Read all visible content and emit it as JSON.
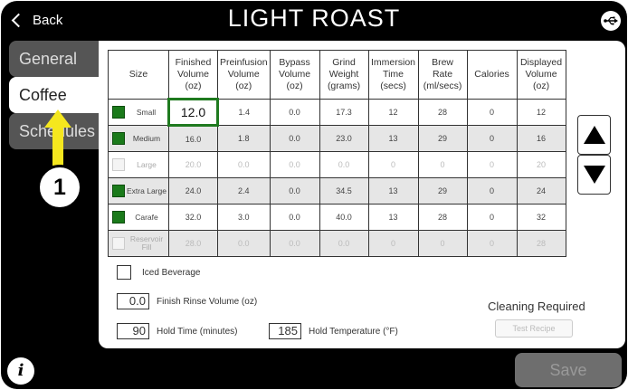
{
  "header": {
    "back_label": "Back",
    "title": "LIGHT ROAST"
  },
  "tabs": [
    {
      "label": "General"
    },
    {
      "label": "Coffee"
    },
    {
      "label": "Schedules"
    }
  ],
  "annotation": {
    "number": "1",
    "arrow_color": "#f5e71e"
  },
  "table": {
    "headers": {
      "size": "Size",
      "finished": [
        "Finished",
        "Volume",
        "(oz)"
      ],
      "preinfusion": [
        "Preinfusion",
        "Volume",
        "(oz)"
      ],
      "bypass": [
        "Bypass",
        "Volume",
        "(oz)"
      ],
      "grind": [
        "Grind",
        "Weight",
        "(grams)"
      ],
      "immersion": [
        "Immersion",
        "Time",
        "(secs)"
      ],
      "brew": [
        "Brew",
        "Rate",
        "(ml/secs)"
      ],
      "calories": [
        "Calories"
      ],
      "displayed": [
        "Displayed",
        "Volume",
        "(oz)"
      ]
    },
    "rows": [
      {
        "size": "Small",
        "checked": "on",
        "finished": "12.0",
        "preinfusion": "1.4",
        "bypass": "0.0",
        "grind": "17.3",
        "immersion": "12",
        "brew": "28",
        "calories": "0",
        "displayed": "12"
      },
      {
        "size": "Medium",
        "checked": "on",
        "finished": "16.0",
        "preinfusion": "1.8",
        "bypass": "0.0",
        "grind": "23.0",
        "immersion": "13",
        "brew": "29",
        "calories": "0",
        "displayed": "16"
      },
      {
        "size": "Large",
        "checked": "off",
        "finished": "20.0",
        "preinfusion": "0.0",
        "bypass": "0.0",
        "grind": "0.0",
        "immersion": "0",
        "brew": "0",
        "calories": "0",
        "displayed": "20"
      },
      {
        "size": "Extra Large",
        "checked": "on",
        "finished": "24.0",
        "preinfusion": "2.4",
        "bypass": "0.0",
        "grind": "34.5",
        "immersion": "13",
        "brew": "29",
        "calories": "0",
        "displayed": "24"
      },
      {
        "size": "Carafe",
        "checked": "on",
        "finished": "32.0",
        "preinfusion": "3.0",
        "bypass": "0.0",
        "grind": "40.0",
        "immersion": "13",
        "brew": "28",
        "calories": "0",
        "displayed": "32"
      },
      {
        "size": "Reservoir Fill",
        "checked": "off",
        "finished": "28.0",
        "preinfusion": "0.0",
        "bypass": "0.0",
        "grind": "0.0",
        "immersion": "0",
        "brew": "0",
        "calories": "0",
        "displayed": "28"
      }
    ]
  },
  "options": {
    "iced_label": "Iced Beverage",
    "rinse_value": "0.0",
    "rinse_label": "Finish Rinse Volume (oz)",
    "hold_time_value": "90",
    "hold_time_label": "Hold Time (minutes)",
    "hold_temp_value": "185",
    "hold_temp_label": "Hold Temperature (°F)"
  },
  "cleaning": {
    "label": "Cleaning Required",
    "test_button": "Test Recipe"
  },
  "footer": {
    "info_label": "i",
    "save_label": "Save"
  },
  "colors": {
    "enabled_checkbox": "#1a7a1a",
    "selected_cell_border": "#1f7a1f"
  }
}
